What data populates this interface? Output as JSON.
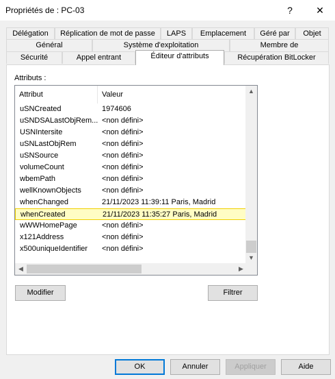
{
  "window": {
    "title": "Propriétés de : PC-03",
    "help_glyph": "?",
    "close_glyph": "✕"
  },
  "tabs": {
    "row1": [
      "Délégation",
      "Réplication de mot de passe",
      "LAPS",
      "Emplacement",
      "Géré par",
      "Objet"
    ],
    "row2": [
      "Général",
      "Système d'exploitation",
      "Membre de"
    ],
    "row3": [
      "Sécurité",
      "Appel entrant",
      "Éditeur d'attributs",
      "Récupération BitLocker"
    ],
    "active": "Éditeur d'attributs"
  },
  "attributes": {
    "label": "Attributs :",
    "columns": [
      "Attribut",
      "Valeur"
    ],
    "rows": [
      {
        "name": "uSNCreated",
        "value": "1974606"
      },
      {
        "name": "uSNDSALastObjRem...",
        "value": "<non défini>"
      },
      {
        "name": "USNIntersite",
        "value": "<non défini>"
      },
      {
        "name": "uSNLastObjRem",
        "value": "<non défini>"
      },
      {
        "name": "uSNSource",
        "value": "<non défini>"
      },
      {
        "name": "volumeCount",
        "value": "<non défini>"
      },
      {
        "name": "wbemPath",
        "value": "<non défini>"
      },
      {
        "name": "wellKnownObjects",
        "value": "<non défini>"
      },
      {
        "name": "whenChanged",
        "value": "21/11/2023 11:39:11 Paris, Madrid"
      },
      {
        "name": "whenCreated",
        "value": "21/11/2023 11:35:27 Paris, Madrid"
      },
      {
        "name": "wWWHomePage",
        "value": "<non défini>"
      },
      {
        "name": "x121Address",
        "value": "<non défini>"
      },
      {
        "name": "x500uniqueIdentifier",
        "value": "<non défini>"
      }
    ],
    "selected_index": 9,
    "up_arrow": "▲",
    "down_arrow": "▼",
    "left_arrow": "◀",
    "right_arrow": "▶"
  },
  "actions": {
    "modify": "Modifier",
    "filter": "Filtrer"
  },
  "footer": {
    "ok": "OK",
    "cancel": "Annuler",
    "apply": "Appliquer",
    "help": "Aide"
  },
  "colors": {
    "selection_fill": "#fffdc4",
    "selection_border": "#f0d000",
    "default_button_border": "#0078d7"
  }
}
